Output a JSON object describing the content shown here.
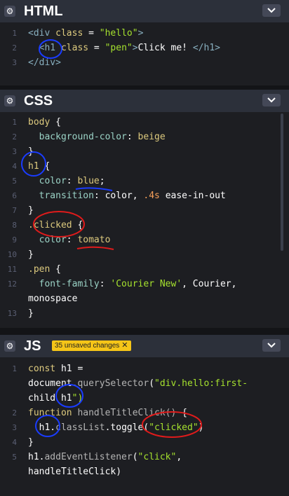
{
  "panels": {
    "html": {
      "title": "HTML",
      "lines": [
        "1",
        "2",
        "3"
      ]
    },
    "css": {
      "title": "CSS",
      "lines": [
        "1",
        "2",
        "3",
        "4",
        "5",
        "6",
        "7",
        "8",
        "9",
        "10",
        "11",
        "12",
        "",
        "13"
      ]
    },
    "js": {
      "title": "JS",
      "badge": "35 unsaved changes",
      "lines": [
        "1",
        "",
        "",
        "2",
        "3",
        "4",
        "5",
        ""
      ]
    }
  },
  "code": {
    "html": [
      {
        "p": [
          "<div ",
          "class",
          " = ",
          "\"hello\"",
          ">"
        ]
      },
      {
        "p": [
          "  <h1 ",
          "class",
          " = ",
          "\"pen\"",
          ">",
          "Click me! ",
          "</h1>"
        ]
      },
      {
        "p": [
          "</div>"
        ]
      }
    ],
    "css": [
      {
        "t": "body {"
      },
      {
        "t": "  background-color: beige"
      },
      {
        "t": "}"
      },
      {
        "t": "h1 {"
      },
      {
        "t": "  color: blue;"
      },
      {
        "t": "  transition: color, .4s ease-in-out"
      },
      {
        "t": "}"
      },
      {
        "t": ".clicked {"
      },
      {
        "t": "  color: tomato"
      },
      {
        "t": "}"
      },
      {
        "t": ".pen {"
      },
      {
        "t": "  font-family: 'Courier New', Courier,"
      },
      {
        "t": "monospace"
      },
      {
        "t": "}"
      }
    ],
    "js": [
      {
        "t": "const h1 ="
      },
      {
        "t": "document.querySelector(\"div.hello:first-"
      },
      {
        "t": "child h1\")"
      },
      {
        "t": "function handleTitleClick() {"
      },
      {
        "t": "  h1.classList.toggle(\"clicked\")"
      },
      {
        "t": "}"
      },
      {
        "t": "h1.addEventListener(\"click\","
      },
      {
        "t": "handleTitleClick)"
      }
    ]
  },
  "icons": {
    "settings": "gear-icon",
    "collapse": "chevron-down-icon",
    "badge_close": "close-icon"
  },
  "colors": {
    "background": "#1d1e22",
    "header": "#2c303a",
    "badge": "#f5c518",
    "annotation_blue": "#1a3cff",
    "annotation_red": "#e01b1b"
  }
}
